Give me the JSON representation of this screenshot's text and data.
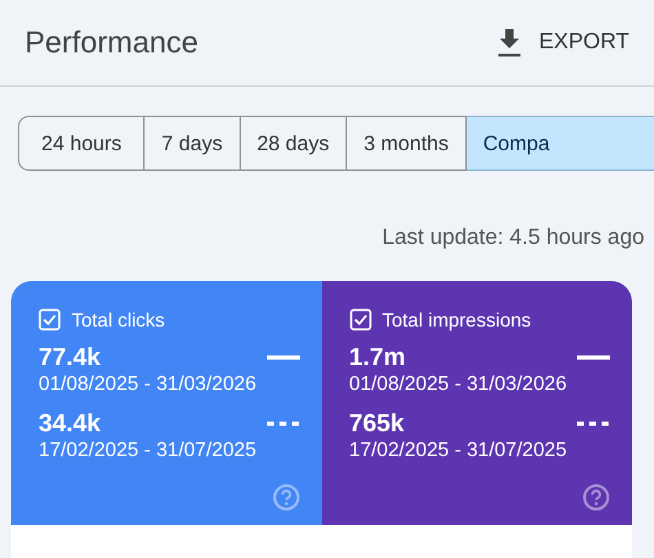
{
  "header": {
    "title": "Performance",
    "export_label": "EXPORT"
  },
  "ranges": [
    {
      "label": "24 hours",
      "selected": false
    },
    {
      "label": "7 days",
      "selected": false
    },
    {
      "label": "28 days",
      "selected": false
    },
    {
      "label": "3 months",
      "selected": false
    },
    {
      "label": "Compa",
      "selected": true
    }
  ],
  "last_update": "Last update: 4.5 hours ago",
  "metrics": [
    {
      "label": "Total clicks",
      "checked": true,
      "color": "#4285f4",
      "periods": [
        {
          "value": "77.4k",
          "range": "01/08/2025 - 31/03/2026",
          "kind": "solid"
        },
        {
          "value": "34.4k",
          "range": "17/02/2025 - 31/07/2025",
          "kind": "dashed"
        }
      ]
    },
    {
      "label": "Total impressions",
      "checked": true,
      "color": "#5e35b1",
      "periods": [
        {
          "value": "1.7m",
          "range": "01/08/2025 - 31/03/2026",
          "kind": "solid"
        },
        {
          "value": "765k",
          "range": "17/02/2025 - 31/07/2025",
          "kind": "dashed"
        }
      ]
    }
  ]
}
